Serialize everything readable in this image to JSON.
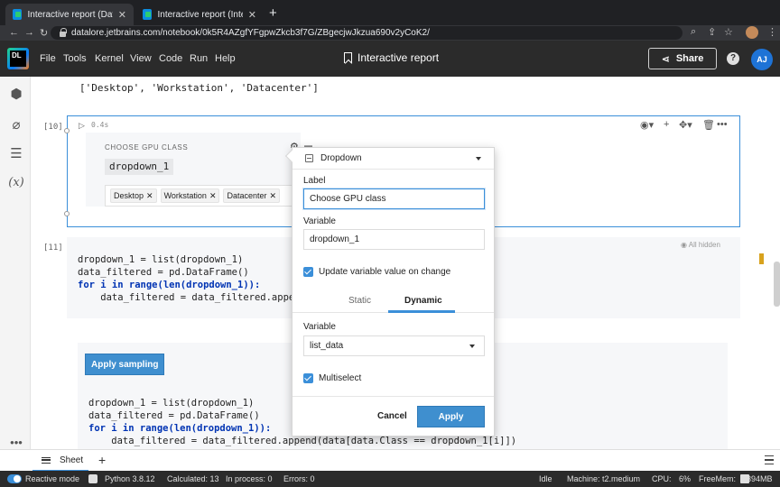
{
  "browser": {
    "tabs": [
      {
        "label": "Interactive report (Datalore no",
        "active": true
      },
      {
        "label": "Interactive report (Interactive r",
        "active": false
      }
    ],
    "url": "datalore.jetbrains.com/notebook/0k5R4AZgfYFgpwZkcb3f7G/ZBgecjwJkzua690v2yCoK2/"
  },
  "header": {
    "logo": "DL",
    "menu": [
      "File",
      "Tools",
      "Kernel",
      "View",
      "Code",
      "Run",
      "Help"
    ],
    "title": "Interactive report",
    "share_label": "Share",
    "help": "?",
    "avatar": "AJ"
  },
  "notebook": {
    "output_list": "['Desktop', 'Workstation', 'Datacenter']",
    "cell10": {
      "number": "[10]",
      "timing": "0.4s",
      "widget": {
        "label": "CHOOSE GPU CLASS",
        "variable": "dropdown_1",
        "chips": [
          "Desktop",
          "Workstation",
          "Datacenter"
        ]
      }
    },
    "cell11": {
      "number": "[11]",
      "all_hidden": "All hidden",
      "lines": [
        "dropdown_1 = list(dropdown_1)",
        "data_filtered = pd.DataFrame()",
        "for i in range(len(dropdown_1)):",
        "    data_filtered = data_filtered.append("
      ]
    },
    "cell12": {
      "button": "Apply sampling",
      "lines": [
        "dropdown_1 = list(dropdown_1)",
        "data_filtered = pd.DataFrame()",
        "for i in range(len(dropdown_1)):",
        "    data_filtered = data_filtered.append(data[data.Class == dropdown_1[i]])"
      ]
    }
  },
  "popup": {
    "type": "Dropdown",
    "label_title": "Label",
    "label_value": "Choose GPU class",
    "variable_title": "Variable",
    "variable_value": "dropdown_1",
    "update_checkbox": "Update variable value on change",
    "tabs": [
      "Static",
      "Dynamic"
    ],
    "active_tab": "Dynamic",
    "dyn_variable_title": "Variable",
    "dyn_variable_value": "list_data",
    "multiselect": "Multiselect",
    "cancel": "Cancel",
    "apply": "Apply"
  },
  "sheetbar": {
    "sheet": "Sheet",
    "add": "+"
  },
  "statusbar": {
    "reactive": "Reactive mode",
    "python": "Python 3.8.12",
    "calculated": "Calculated: 13",
    "in_process": "In process: 0",
    "errors": "Errors: 0",
    "idle": "Idle",
    "machine": "Machine: t2.medium",
    "cpu_label": "CPU:",
    "cpu_value": "6%",
    "freemem_label": "FreeMem:",
    "freemem_value": "2394MB"
  }
}
